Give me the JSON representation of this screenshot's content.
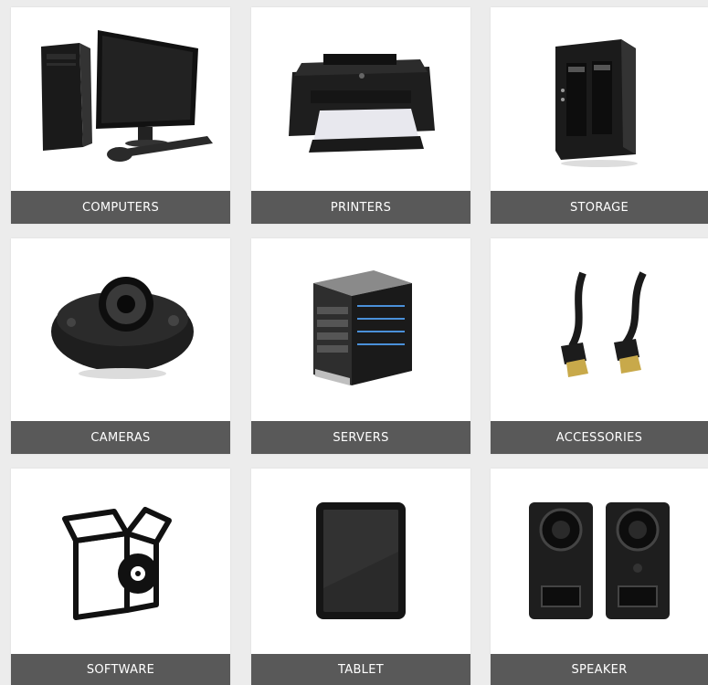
{
  "categories": [
    {
      "label": "COMPUTERS",
      "icon": "desktop-computer-icon"
    },
    {
      "label": "PRINTERS",
      "icon": "printer-icon"
    },
    {
      "label": "STORAGE",
      "icon": "nas-storage-icon"
    },
    {
      "label": "CAMERAS",
      "icon": "conference-camera-icon"
    },
    {
      "label": "SERVERS",
      "icon": "server-rack-icon"
    },
    {
      "label": "ACCESSORIES",
      "icon": "hdmi-cable-icon"
    },
    {
      "label": "SOFTWARE",
      "icon": "software-box-icon"
    },
    {
      "label": "TABLET",
      "icon": "tablet-icon"
    },
    {
      "label": "SPEAKER",
      "icon": "speakers-icon"
    }
  ],
  "colors": {
    "label_bg": "#595959",
    "label_text": "#ffffff",
    "page_bg": "#ececec",
    "tile_bg": "#ffffff"
  }
}
